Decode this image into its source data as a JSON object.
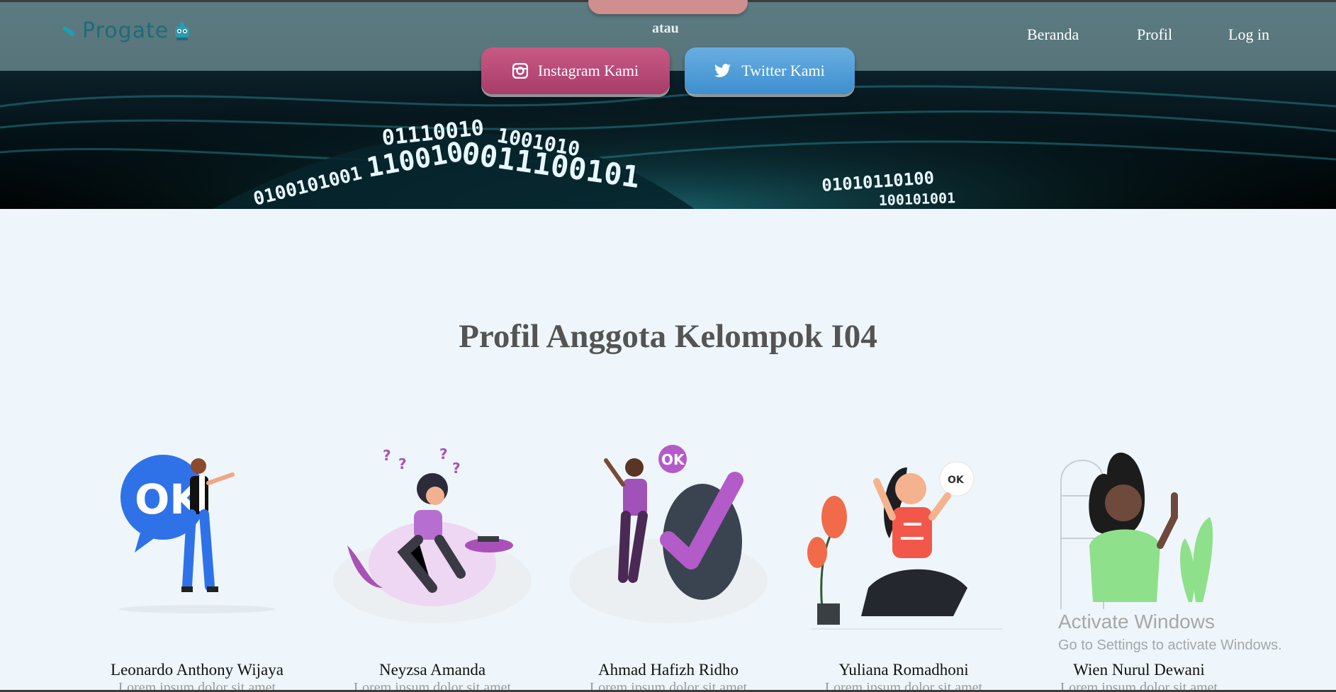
{
  "header": {
    "logo_text": "Progate",
    "nav": {
      "home": "Beranda",
      "profile": "Profil",
      "login": "Log in"
    }
  },
  "hero": {
    "separator": "atau",
    "instagram_label": "Instagram Kami",
    "twitter_label": "Twitter Kami"
  },
  "section": {
    "title": "Profil Anggota Kelompok I04"
  },
  "members": [
    {
      "name": "Leonardo Anthony Wijaya",
      "desc": "Lorem ipsum dolor sit amet",
      "badge": "OK"
    },
    {
      "name": "Neyzsa Amanda",
      "desc": "Lorem ipsum dolor sit amet"
    },
    {
      "name": "Ahmad Hafizh Ridho",
      "desc": "Lorem ipsum dolor sit amet",
      "badge": "OK"
    },
    {
      "name": "Yuliana Romadhoni",
      "desc": "Lorem ipsum dolor sit amet",
      "badge": "OK"
    },
    {
      "name": "Wien Nurul Dewani",
      "desc": "Lorem ipsum dolor sit amet"
    }
  ],
  "watermark": {
    "line1": "Activate Windows",
    "line2": "Go to Settings to activate Windows."
  },
  "colors": {
    "instagram": "#b04873",
    "twitter": "#4a9ad6",
    "brand": "#1f6b7a"
  },
  "icons": [
    "progate-logo-icon",
    "instagram-icon",
    "twitter-icon"
  ]
}
